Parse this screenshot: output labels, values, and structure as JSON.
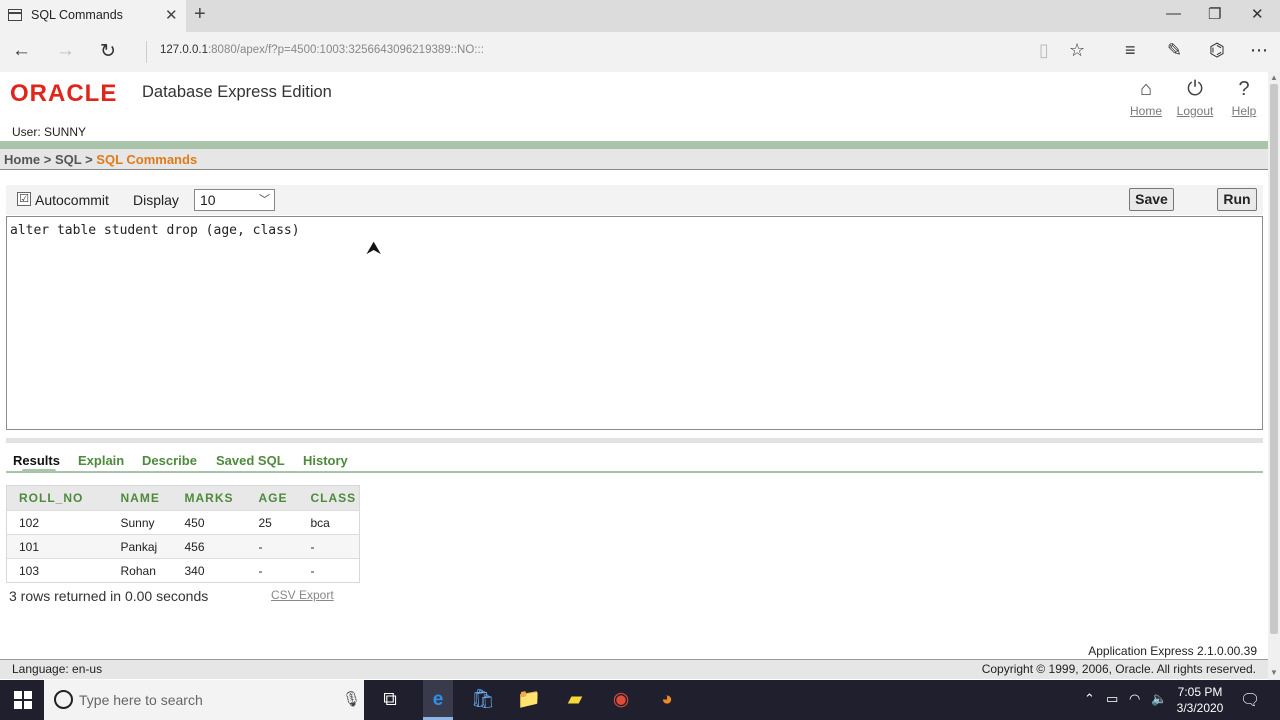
{
  "browser": {
    "tab_title": "SQL Commands",
    "tab_close": "✕",
    "new_tab": "+",
    "win_min": "—",
    "win_restore": "❐",
    "win_close": "✕",
    "back": "←",
    "forward": "→",
    "refresh": "↻",
    "address_host": "127.0.0.1",
    "address_rest": ":8080/apex/f?p=4500:1003:3256643096219389::NO:::",
    "reading_view_icon": "reading-view-icon",
    "favorite_icon": "star-icon",
    "hub_icon": "hub-icon",
    "notes_icon": "pen-icon",
    "share_icon": "share-icon",
    "more_icon": "more-icon"
  },
  "header": {
    "logo": "ORACLE",
    "product": "Database Express Edition",
    "user_line": "User: SUNNY",
    "links": [
      {
        "label": "Home",
        "icon": "home-icon",
        "glyph": "⌂"
      },
      {
        "label": "Logout",
        "icon": "power-icon",
        "glyph": "⏻"
      },
      {
        "label": "Help",
        "icon": "help-icon",
        "glyph": "?"
      }
    ]
  },
  "breadcrumb": {
    "home": "Home",
    "sep1": " > ",
    "sql": "SQL",
    "sep2": " > ",
    "current": "SQL Commands"
  },
  "toolbar": {
    "autocommit_label": "Autocommit",
    "autocommit_checked": "☑",
    "display_label": "Display",
    "display_value": "10",
    "save_label": "Save",
    "run_label": "Run"
  },
  "editor": {
    "sql": "alter table student drop (age, class)"
  },
  "result_tabs": [
    {
      "label": "Results",
      "active": true
    },
    {
      "label": "Explain"
    },
    {
      "label": "Describe"
    },
    {
      "label": "Saved SQL"
    },
    {
      "label": "History"
    }
  ],
  "results": {
    "columns": [
      "ROLL_NO",
      "NAME",
      "MARKS",
      "AGE",
      "CLASS"
    ],
    "rows": [
      [
        "102",
        "Sunny",
        "450",
        "25",
        "bca"
      ],
      [
        "101",
        "Pankaj",
        "456",
        "-",
        "-"
      ],
      [
        "103",
        "Rohan",
        "340",
        "-",
        "-"
      ]
    ],
    "summary": "3 rows returned in 0.00 seconds",
    "csv_export": "CSV Export"
  },
  "footer": {
    "app_version": "Application Express 2.1.0.00.39",
    "language": "Language: en-us",
    "copyright": "Copyright © 1999, 2006, Oracle. All rights reserved."
  },
  "taskbar": {
    "search_placeholder": "Type here to search",
    "time": "7:05 PM",
    "date": "3/3/2020"
  }
}
